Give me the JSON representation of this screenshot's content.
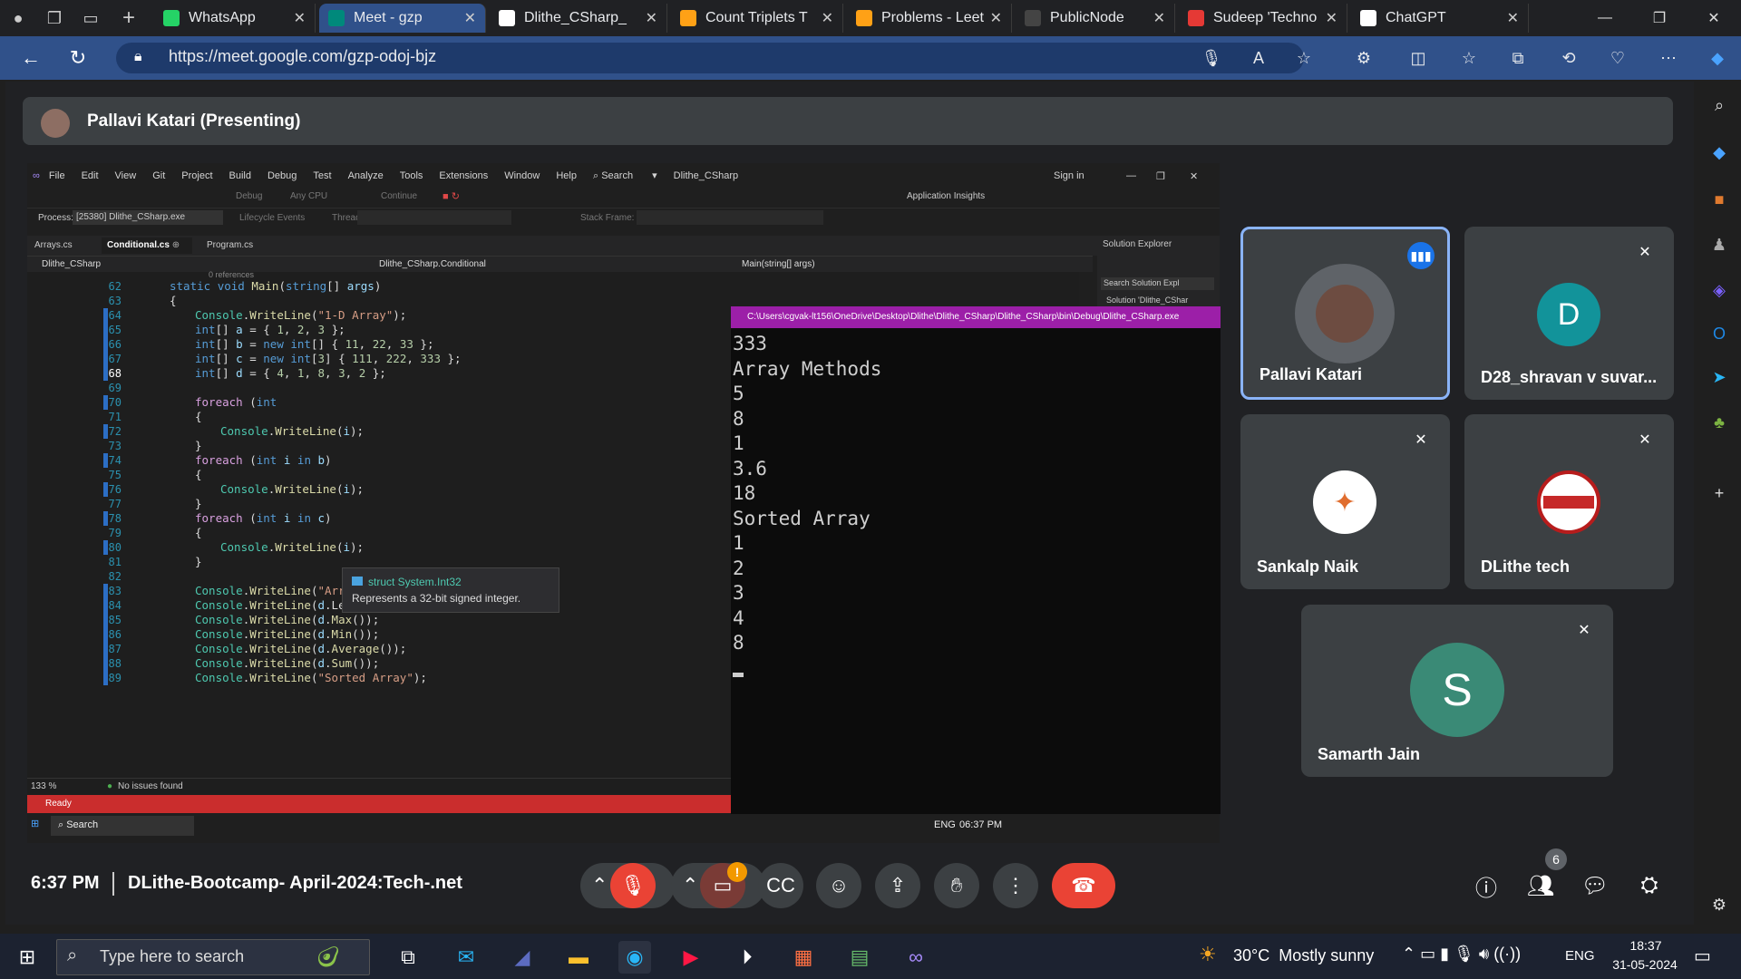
{
  "browser": {
    "tabs": [
      {
        "title": "WhatsApp",
        "icon": "whatsapp-icon",
        "color": "#25d366"
      },
      {
        "title": "Meet - gzp",
        "icon": "meet-icon",
        "color": "#00897b",
        "active": true
      },
      {
        "title": "Dlithe_CSharp_",
        "icon": "github-icon",
        "color": "#ffffff"
      },
      {
        "title": "Count Triplets T",
        "icon": "leetcode-icon",
        "color": "#ffa116"
      },
      {
        "title": "Problems - Leet",
        "icon": "leetcode-icon",
        "color": "#ffa116"
      },
      {
        "title": "PublicNode",
        "icon": "publicnode-icon",
        "color": "#444444"
      },
      {
        "title": "Sudeep 'Techno",
        "icon": "pdf-icon",
        "color": "#e53935"
      },
      {
        "title": "ChatGPT",
        "icon": "chatgpt-icon",
        "color": "#ffffff"
      }
    ],
    "url": "https://meet.google.com/gzp-odoj-bjz"
  },
  "meet": {
    "presenting_title": "Pallavi Katari (Presenting)",
    "time": "6:37 PM",
    "meeting_name": "DLithe-Bootcamp- April-2024:Tech-.net",
    "participant_count": "6",
    "participants": [
      {
        "name": "Pallavi Katari",
        "speaking": true
      },
      {
        "name": "D28_shravan v suvar...",
        "initial": "D",
        "color": "#12939a"
      },
      {
        "name": "Sankalp Naik"
      },
      {
        "name": "DLithe tech"
      },
      {
        "name": "Samarth Jain",
        "initial": "S",
        "color": "#3a8a76"
      }
    ],
    "warning_badge": "!"
  },
  "vs": {
    "menu": [
      "File",
      "Edit",
      "View",
      "Git",
      "Project",
      "Build",
      "Debug",
      "Test",
      "Analyze",
      "Tools",
      "Extensions",
      "Window",
      "Help"
    ],
    "search": "Search",
    "solution_name": "Dlithe_CSharp",
    "sign_in": "Sign in",
    "toolbar": {
      "config": "Debug",
      "platform": "Any CPU",
      "continue": "Continue",
      "insights": "Application Insights"
    },
    "process_label": "Process:",
    "process": "[25380] Dlithe_CSharp.exe",
    "lifecycle": "Lifecycle Events",
    "thread": "Thread:",
    "stack_frame": "Stack Frame:",
    "file_tabs": [
      "Arrays.cs",
      "Conditional.cs",
      "Program.cs"
    ],
    "crumbs": [
      "Dlithe_CSharp",
      "Dlithe_CSharp.Conditional",
      "Main(string[] args)"
    ],
    "references": "0 references",
    "solution_explorer": "Solution Explorer",
    "sol_search": "Search Solution Expl",
    "sol_item": "Solution 'Dlithe_CShar",
    "zoom": "133 %",
    "issues": "No issues found",
    "ready": "Ready",
    "tooltip_title": "struct System.Int32",
    "tooltip_desc": "Represents a 32-bit signed integer.",
    "taskbar_search": "Search",
    "taskbar_lang": "ENG",
    "taskbar_time": "06:37 PM",
    "code_lines": [
      {
        "n": "62",
        "text": "static void Main(string[] args)"
      },
      {
        "n": "63",
        "text": "{"
      },
      {
        "n": "64",
        "text": "Console.WriteLine(\"1-D Array\");"
      },
      {
        "n": "65",
        "text": "int[] a = { 1, 2, 3 };"
      },
      {
        "n": "66",
        "text": "int[] b = new int[] { 11, 22, 33 };"
      },
      {
        "n": "67",
        "text": "int[] c = new int[3] { 111, 222, 333 };"
      },
      {
        "n": "68",
        "text": "int[] d = { 4, 1, 8, 3, 2 };"
      },
      {
        "n": "69",
        "text": ""
      },
      {
        "n": "70",
        "text": "foreach (int"
      },
      {
        "n": "71",
        "text": "{"
      },
      {
        "n": "72",
        "text": "Console.WriteLine(i);"
      },
      {
        "n": "73",
        "text": "}"
      },
      {
        "n": "74",
        "text": "foreach (int i in b)"
      },
      {
        "n": "75",
        "text": "{"
      },
      {
        "n": "76",
        "text": "Console.WriteLine(i);"
      },
      {
        "n": "77",
        "text": "}"
      },
      {
        "n": "78",
        "text": "foreach (int i in c)"
      },
      {
        "n": "79",
        "text": "{"
      },
      {
        "n": "80",
        "text": "Console.WriteLine(i);"
      },
      {
        "n": "81",
        "text": "}"
      },
      {
        "n": "82",
        "text": ""
      },
      {
        "n": "83",
        "text": "Console.WriteLine(\"Array Methods\");"
      },
      {
        "n": "84",
        "text": "Console.WriteLine(d.Length);"
      },
      {
        "n": "85",
        "text": "Console.WriteLine(d.Max());"
      },
      {
        "n": "86",
        "text": "Console.WriteLine(d.Min());"
      },
      {
        "n": "87",
        "text": "Console.WriteLine(d.Average());"
      },
      {
        "n": "88",
        "text": "Console.WriteLine(d.Sum());"
      },
      {
        "n": "89",
        "text": "Console.WriteLine(\"Sorted Array\");"
      }
    ]
  },
  "console": {
    "title": "C:\\Users\\cgvak-lt156\\OneDrive\\Desktop\\Dlithe\\Dlithe_CSharp\\Dlithe_CSharp\\bin\\Debug\\Dlithe_CSharp.exe",
    "lines": [
      "333",
      "Array Methods",
      "5",
      "8",
      "1",
      "3.6",
      "18",
      "Sorted Array",
      "1",
      "2",
      "3",
      "4",
      "8"
    ]
  },
  "windows": {
    "search_placeholder": "Type here to search",
    "weather": "30°C  Mostly sunny",
    "lang": "ENG",
    "time": "18:37",
    "date": "31-05-2024"
  }
}
